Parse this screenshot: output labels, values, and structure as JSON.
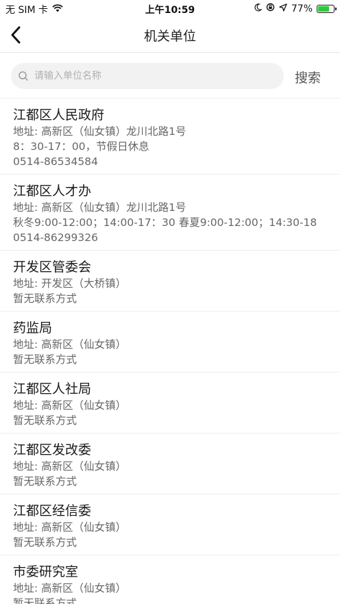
{
  "status_bar": {
    "carrier": "无 SIM 卡",
    "time": "上午10:59",
    "battery_percent": "77%",
    "battery_level": 0.77,
    "battery_color": "#2ec93c"
  },
  "nav": {
    "title": "机关单位"
  },
  "search": {
    "placeholder": "请输入单位名称",
    "value": "",
    "button_label": "搜索"
  },
  "units": [
    {
      "name": "江都区人民政府",
      "lines": [
        "地址: 高新区（仙女镇）龙川北路1号",
        "8：30-17：00，节假日休息",
        "0514-86534584"
      ]
    },
    {
      "name": "江都区人才办",
      "lines": [
        "地址: 高新区（仙女镇）龙川北路1号",
        "秋冬9:00-12:00；14:00-17：30 春夏9:00-12:00；14:30-18",
        "0514-86299326"
      ]
    },
    {
      "name": "开发区管委会",
      "lines": [
        "地址: 开发区（大桥镇）",
        "暂无联系方式"
      ]
    },
    {
      "name": "药监局",
      "lines": [
        "地址: 高新区（仙女镇）",
        "暂无联系方式"
      ]
    },
    {
      "name": "江都区人社局",
      "lines": [
        "地址: 高新区（仙女镇）",
        "暂无联系方式"
      ]
    },
    {
      "name": "江都区发改委",
      "lines": [
        "地址: 高新区（仙女镇）",
        "暂无联系方式"
      ]
    },
    {
      "name": "江都区经信委",
      "lines": [
        "地址: 高新区（仙女镇）",
        "暂无联系方式"
      ]
    },
    {
      "name": "市委研究室",
      "lines": [
        "地址: 高新区（仙女镇）",
        "暂无联系方式"
      ]
    }
  ]
}
